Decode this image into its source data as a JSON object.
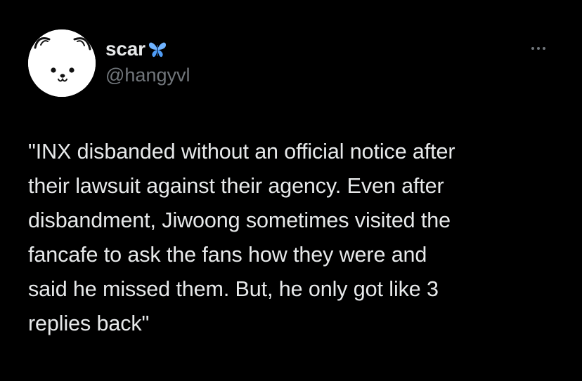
{
  "tweet": {
    "author": {
      "display_name": "scar",
      "name_emoji": "blue-butterfly-emoji",
      "handle": "@hangyvl",
      "avatar": "white-cartoon-bear-avatar"
    },
    "more_icon": "more-options-icon",
    "text_lines": [
      "\"INX disbanded without an official notice after",
      "their lawsuit against their agency. Even after",
      "disbandment, Jiwoong sometimes visited the",
      "fancafe to ask the fans how they were and",
      "said he missed them. But, he only got like 3",
      "replies back\""
    ]
  },
  "colors": {
    "background": "#000000",
    "primary_text": "#e7e9ea",
    "secondary_text": "#71767b",
    "butterfly": "#6fb3ff"
  }
}
